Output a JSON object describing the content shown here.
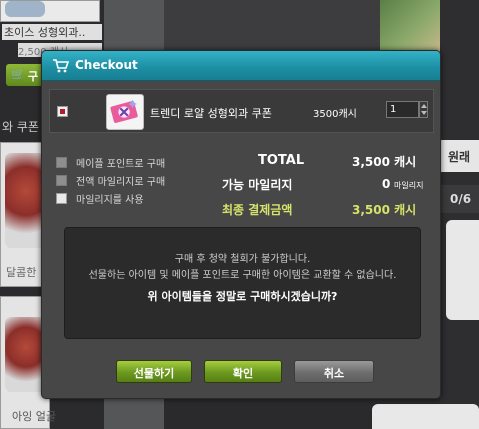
{
  "background": {
    "item_name_1": "초이스 성형외과..",
    "item_price_1": "2,500 캐시",
    "buy_button_1": "구",
    "section_label": "와 쿠폰",
    "item_name_2": "달콤한",
    "item_name_3": "아잉 얼굴",
    "right_tab_label": "원래",
    "right_counter": "0/6"
  },
  "dialog": {
    "title": "Checkout",
    "item": {
      "checked": true,
      "name": "트렌디 로얄 성형외과 쿠폰",
      "price": "3500캐시",
      "quantity": "1"
    },
    "options": [
      {
        "label": "메이플 포인트로 구매",
        "disabled": true
      },
      {
        "label": "전액 마일리지로 구매",
        "disabled": true
      },
      {
        "label": "마일리지를 사용",
        "disabled": false
      }
    ],
    "summary": {
      "total_label": "TOTAL",
      "total_value": "3,500 캐시",
      "mileage_label": "가능 마일리지",
      "mileage_value": "0",
      "mileage_unit": "마일리지",
      "final_label": "최종 결제금액",
      "final_value": "3,500 캐시"
    },
    "notice": {
      "line1": "구매 후 청약 철회가 불가합니다.",
      "line2": "선물하는 아이템 및 메이플 포인트로 구매한 아이템은 교환할 수 없습니다.",
      "question": "위 아이템들을 정말로 구매하시겠습니까?"
    },
    "buttons": {
      "gift": "선물하기",
      "confirm": "확인",
      "cancel": "취소"
    }
  },
  "colors": {
    "title_bar": "#1d8ea3",
    "final_amount": "#d6e36a",
    "button_green": "#6c9a1f",
    "button_gray": "#6e6e6e"
  }
}
